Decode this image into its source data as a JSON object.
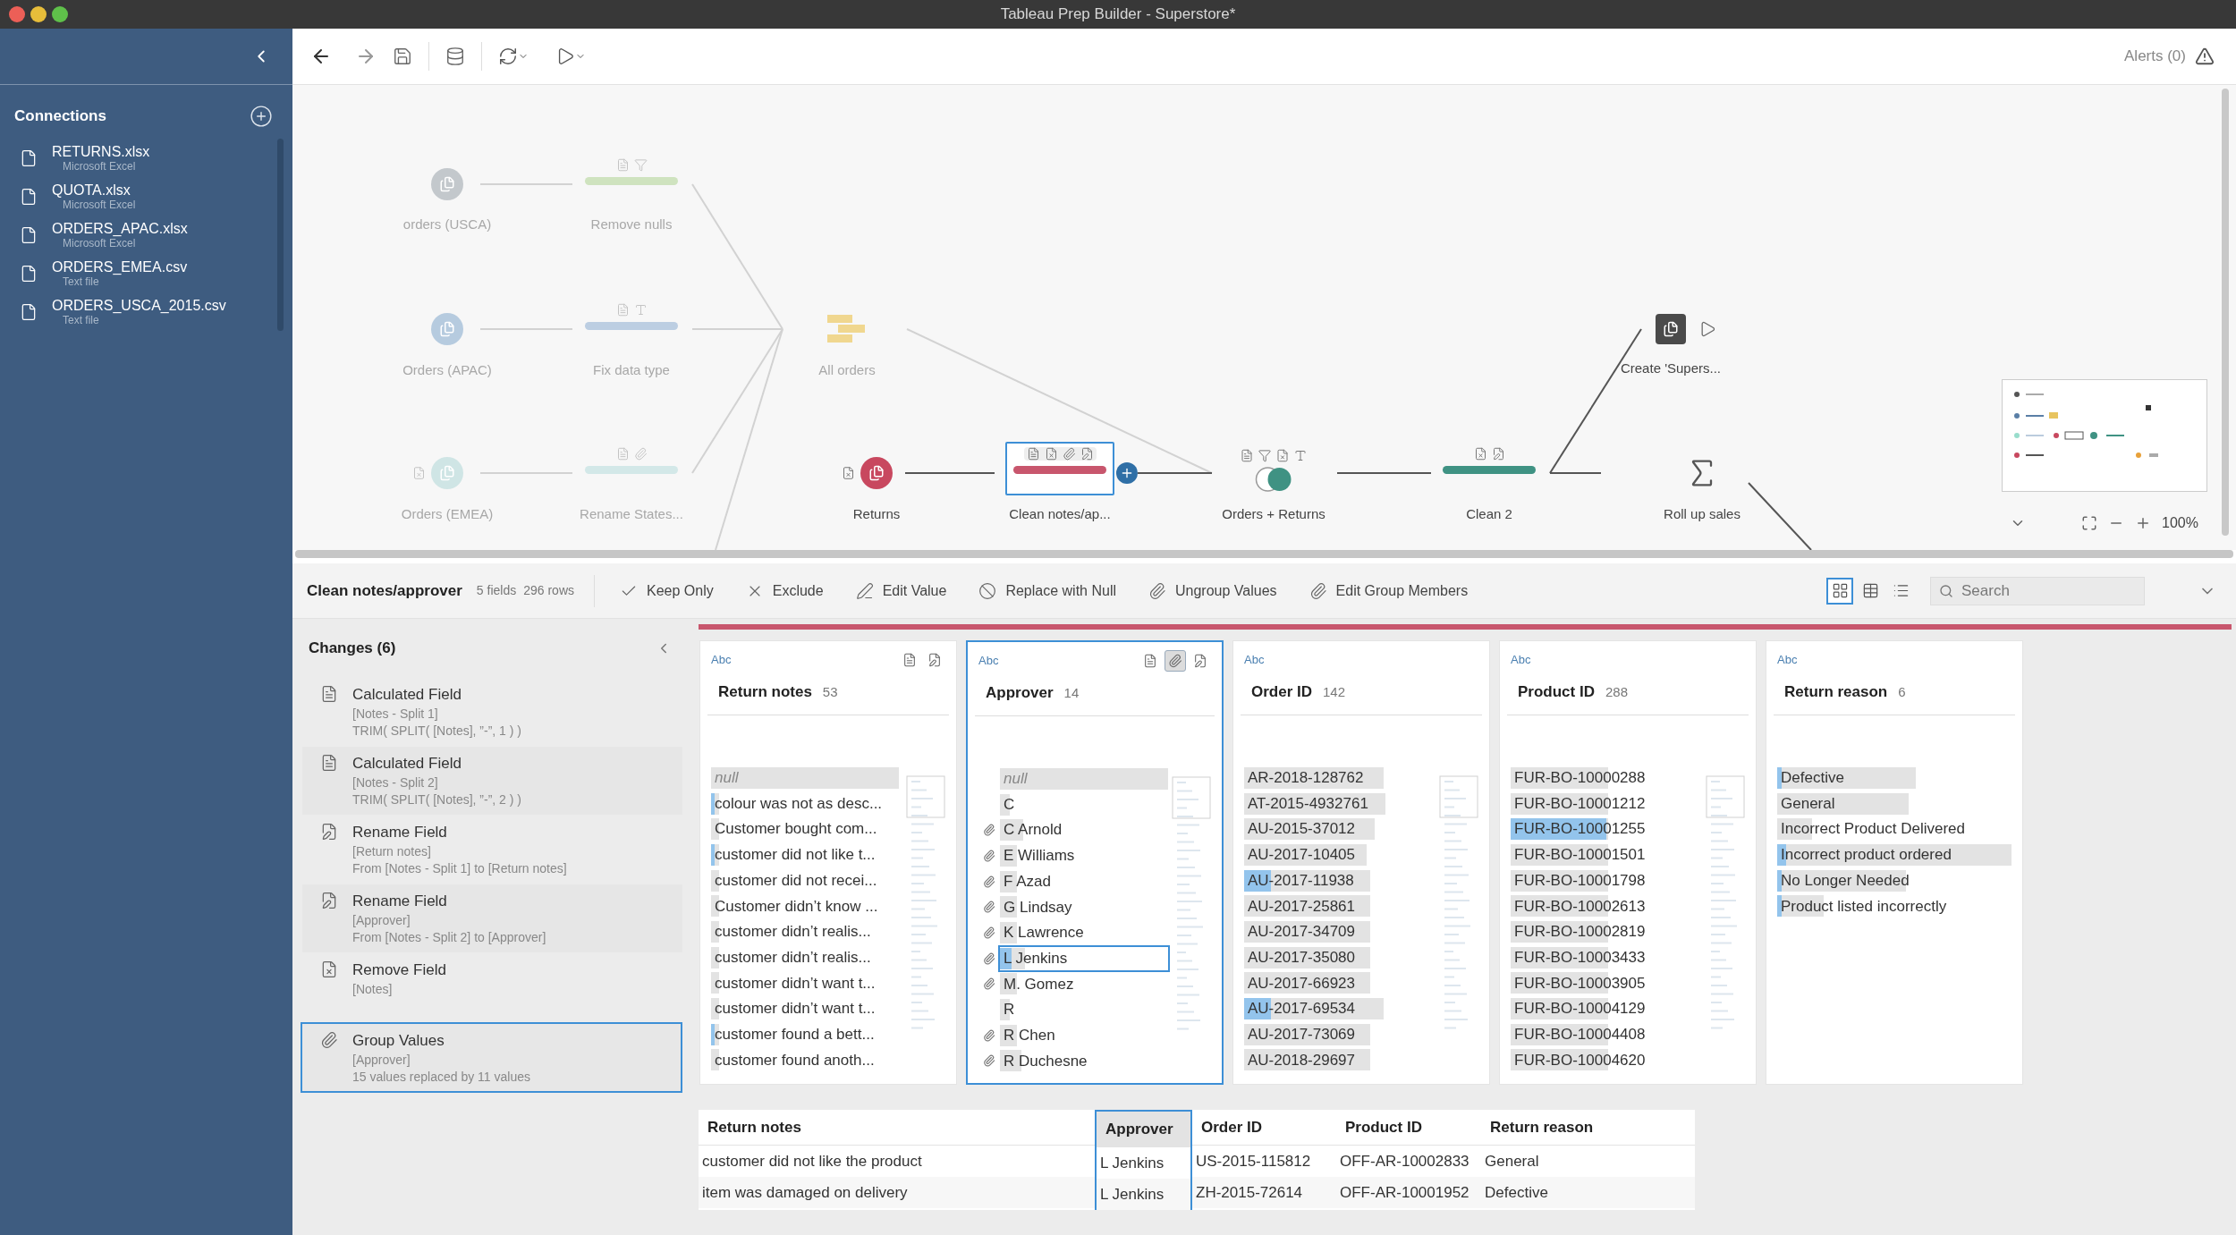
{
  "window": {
    "title": "Tableau Prep Builder - Superstore*"
  },
  "sidebar": {
    "title": "Connections",
    "items": [
      {
        "name": "RETURNS.xlsx",
        "type": "Microsoft Excel"
      },
      {
        "name": "QUOTA.xlsx",
        "type": "Microsoft Excel"
      },
      {
        "name": "ORDERS_APAC.xlsx",
        "type": "Microsoft Excel"
      },
      {
        "name": "ORDERS_EMEA.csv",
        "type": "Text file"
      },
      {
        "name": "ORDERS_USCA_2015.csv",
        "type": "Text file"
      }
    ]
  },
  "toolbar": {
    "alerts": "Alerts (0)"
  },
  "flow": {
    "zoom": "100%",
    "nodes": [
      {
        "kind": "input",
        "label": "orders (USCA)",
        "color": "#c3c8cc",
        "faded": true,
        "selected": false
      },
      {
        "kind": "clean",
        "label": "Remove nulls",
        "color": "#cfe3bf",
        "faded": true,
        "selected": false
      },
      {
        "kind": "input",
        "label": "Orders (APAC)",
        "color": "#b6cbdf",
        "faded": true,
        "selected": false
      },
      {
        "kind": "clean",
        "label": "Fix data type",
        "color": "#bccee2",
        "faded": true,
        "selected": false
      },
      {
        "kind": "input",
        "label": "Orders (EMEA)",
        "color": "#cfe5e5",
        "faded": true,
        "selected": false
      },
      {
        "kind": "clean",
        "label": "Rename States...",
        "color": "#d3e8e8",
        "faded": true,
        "selected": false
      },
      {
        "kind": "union",
        "label": "All orders",
        "color": "#f0d78f",
        "faded": true,
        "selected": false
      },
      {
        "kind": "input",
        "label": "Returns",
        "color": "#c8485f",
        "faded": false,
        "selected": false
      },
      {
        "kind": "clean",
        "label": "Clean notes/ap...",
        "color": "#c8566d",
        "faded": false,
        "selected": true
      },
      {
        "kind": "join",
        "label": "Orders + Returns",
        "color": "#3f9283",
        "faded": false,
        "selected": false
      },
      {
        "kind": "clean",
        "label": "Clean 2",
        "color": "#3f9283",
        "faded": false,
        "selected": false
      },
      {
        "kind": "output",
        "label": "Create 'Supers...",
        "color": "#4a4a4a",
        "faded": false,
        "selected": false
      },
      {
        "kind": "aggregate",
        "label": "Roll up sales",
        "color": "#555555",
        "faded": false,
        "selected": false
      }
    ]
  },
  "step": {
    "title": "Clean notes/approver",
    "fields": "5 fields",
    "rows": "296 rows",
    "color": "#c8566d",
    "search": {
      "placeholder": "Search"
    },
    "actions": [
      {
        "kind": "keep",
        "label": "Keep Only"
      },
      {
        "kind": "exclude",
        "label": "Exclude"
      },
      {
        "kind": "edit",
        "label": "Edit Value"
      },
      {
        "kind": "null",
        "label": "Replace with Null"
      },
      {
        "kind": "ungroup",
        "label": "Ungroup Values"
      },
      {
        "kind": "group",
        "label": "Edit Group Members"
      }
    ],
    "views": [
      {
        "kind": "profile",
        "selected": true
      },
      {
        "kind": "table",
        "selected": false
      },
      {
        "kind": "list",
        "selected": false
      }
    ]
  },
  "changes": {
    "title": "Changes (6)",
    "items": [
      {
        "kind": "calc",
        "title": "Calculated Field",
        "lines": [
          "[Notes - Split 1]",
          "TRIM( SPLIT( [Notes], ”-”, 1 ) )"
        ],
        "selected": false
      },
      {
        "kind": "calc",
        "title": "Calculated Field",
        "lines": [
          "[Notes - Split 2]",
          "TRIM( SPLIT( [Notes], ”-”, 2 ) )"
        ],
        "selected": false
      },
      {
        "kind": "rename",
        "title": "Rename Field",
        "lines": [
          "[Return notes]",
          "From [Notes - Split 1] to [Return notes]"
        ],
        "selected": false
      },
      {
        "kind": "rename",
        "title": "Rename Field",
        "lines": [
          "[Approver]",
          "From [Notes - Split 2] to [Approver]"
        ],
        "selected": false
      },
      {
        "kind": "remove",
        "title": "Remove Field",
        "lines": [
          "[Notes]"
        ],
        "selected": false
      },
      {
        "kind": "group",
        "title": "Group Values",
        "lines": [
          "[Approver]",
          "15 values replaced by 11 values"
        ],
        "selected": true
      }
    ]
  },
  "profile": {
    "cards": [
      {
        "type": "Abc",
        "title": "Return notes",
        "count": "53",
        "selected": false,
        "tools": [
          {
            "kind": "calc",
            "selected": false
          },
          {
            "kind": "rename",
            "selected": false
          }
        ],
        "values": [
          {
            "kind": "null",
            "text": "null",
            "level": 0.98,
            "selected": false
          },
          {
            "kind": "value",
            "text": "colour was not as desc...",
            "level": 0.04,
            "highlight": {
              "level": 0.02
            },
            "selected": false
          },
          {
            "kind": "value",
            "text": "Customer bought com...",
            "level": 0.04,
            "selected": false
          },
          {
            "kind": "value",
            "text": "customer did not like t...",
            "level": 0.04,
            "highlight": {
              "level": 0.02
            },
            "selected": false
          },
          {
            "kind": "value",
            "text": "customer did not recei...",
            "level": 0.04,
            "selected": false
          },
          {
            "kind": "value",
            "text": "Customer didn’t know ...",
            "level": 0.04,
            "selected": false
          },
          {
            "kind": "value",
            "text": "customer didn’t realis...",
            "level": 0.04,
            "selected": false
          },
          {
            "kind": "value",
            "text": "customer didn’t realis...",
            "level": 0.04,
            "selected": false
          },
          {
            "kind": "value",
            "text": "customer didn’t want t...",
            "level": 0.04,
            "selected": false
          },
          {
            "kind": "value",
            "text": "customer didn’t want t...",
            "level": 0.04,
            "selected": false
          },
          {
            "kind": "value",
            "text": "customer found a bett...",
            "level": 0.04,
            "highlight": {
              "level": 0.02
            },
            "selected": false
          },
          {
            "kind": "value",
            "text": "customer found anoth...",
            "level": 0.04,
            "selected": false
          }
        ]
      },
      {
        "type": "Abc",
        "title": "Approver",
        "count": "14",
        "selected": true,
        "tools": [
          {
            "kind": "calc",
            "selected": false
          },
          {
            "kind": "group",
            "selected": true
          },
          {
            "kind": "rename",
            "selected": false
          }
        ],
        "values": [
          {
            "kind": "null",
            "text": "null",
            "level": 1,
            "selected": false,
            "grouped": false
          },
          {
            "kind": "value",
            "text": "C",
            "level": 0.06,
            "selected": false,
            "grouped": false
          },
          {
            "kind": "value",
            "text": "C Arnold",
            "level": 0.14,
            "selected": false,
            "grouped": true
          },
          {
            "kind": "value",
            "text": "E Williams",
            "level": 0.1,
            "selected": false,
            "grouped": true
          },
          {
            "kind": "value",
            "text": "F Azad",
            "level": 0.1,
            "selected": false,
            "grouped": true
          },
          {
            "kind": "value",
            "text": "G Lindsay",
            "level": 0.1,
            "selected": false,
            "grouped": true
          },
          {
            "kind": "value",
            "text": "K Lawrence",
            "level": 0.1,
            "selected": false,
            "grouped": true
          },
          {
            "kind": "value",
            "text": "L Jenkins",
            "level": 0.15,
            "highlight": {
              "level": 0.07
            },
            "selected": true,
            "grouped": true
          },
          {
            "kind": "value",
            "text": "M.  Gomez",
            "level": 0.1,
            "selected": false,
            "grouped": true
          },
          {
            "kind": "value",
            "text": "R",
            "level": 0.06,
            "selected": false,
            "grouped": false
          },
          {
            "kind": "value",
            "text": "R Chen",
            "level": 0.1,
            "selected": false,
            "grouped": true
          },
          {
            "kind": "value",
            "text": "R Duchesne",
            "level": 0.13,
            "selected": false,
            "grouped": true
          }
        ]
      },
      {
        "type": "Abc",
        "title": "Order ID",
        "count": "142",
        "selected": false,
        "values": [
          {
            "kind": "value",
            "text": "AR-2018-128762",
            "level": 0.73,
            "selected": false
          },
          {
            "kind": "value",
            "text": "AT-2015-4932761",
            "level": 0.74,
            "selected": false
          },
          {
            "kind": "value",
            "text": "AU-2015-37012",
            "level": 0.68,
            "selected": false
          },
          {
            "kind": "value",
            "text": "AU-2017-10405",
            "level": 0.64,
            "selected": false
          },
          {
            "kind": "value",
            "text": "AU-2017-11938",
            "level": 0.66,
            "highlight": {
              "level": 0.14
            },
            "selected": false
          },
          {
            "kind": "value",
            "text": "AU-2017-25861",
            "level": 0.66,
            "selected": false
          },
          {
            "kind": "value",
            "text": "AU-2017-34709",
            "level": 0.66,
            "selected": false
          },
          {
            "kind": "value",
            "text": "AU-2017-35080",
            "level": 0.66,
            "selected": false
          },
          {
            "kind": "value",
            "text": "AU-2017-66923",
            "level": 0.66,
            "selected": false
          },
          {
            "kind": "value",
            "text": "AU-2017-69534",
            "level": 0.73,
            "highlight": {
              "level": 0.14
            },
            "selected": false
          },
          {
            "kind": "value",
            "text": "AU-2017-73069",
            "level": 0.66,
            "selected": false
          },
          {
            "kind": "value",
            "text": "AU-2018-29697",
            "level": 0.66,
            "selected": false
          }
        ]
      },
      {
        "type": "Abc",
        "title": "Product ID",
        "count": "288",
        "selected": false,
        "values": [
          {
            "kind": "value",
            "text": "FUR-BO-10000288",
            "level": 0.51,
            "selected": false
          },
          {
            "kind": "value",
            "text": "FUR-BO-10001212",
            "level": 0.51,
            "selected": false
          },
          {
            "kind": "value",
            "text": "FUR-BO-10001255",
            "level": 0.51,
            "highlight": {
              "level": 0.5
            },
            "selected": false
          },
          {
            "kind": "value",
            "text": "FUR-BO-10001501",
            "level": 0.51,
            "selected": false
          },
          {
            "kind": "value",
            "text": "FUR-BO-10001798",
            "level": 0.51,
            "selected": false
          },
          {
            "kind": "value",
            "text": "FUR-BO-10002613",
            "level": 0.51,
            "selected": false
          },
          {
            "kind": "value",
            "text": "FUR-BO-10002819",
            "level": 0.51,
            "selected": false
          },
          {
            "kind": "value",
            "text": "FUR-BO-10003433",
            "level": 0.51,
            "selected": false
          },
          {
            "kind": "value",
            "text": "FUR-BO-10003905",
            "level": 0.51,
            "selected": false
          },
          {
            "kind": "value",
            "text": "FUR-BO-10004129",
            "level": 0.51,
            "selected": false
          },
          {
            "kind": "value",
            "text": "FUR-BO-10004408",
            "level": 0.51,
            "selected": false
          },
          {
            "kind": "value",
            "text": "FUR-BO-10004620",
            "level": 0.51,
            "selected": false
          }
        ]
      },
      {
        "type": "Abc",
        "title": "Return reason",
        "count": "6",
        "selected": false,
        "values": [
          {
            "kind": "value",
            "text": "Defective",
            "level": 0.59,
            "highlight": {
              "level": 0.02
            },
            "selected": false
          },
          {
            "kind": "value",
            "text": "General",
            "level": 0.56,
            "selected": false
          },
          {
            "kind": "value",
            "text": "Incorrect Product Delivered",
            "level": 0.15,
            "selected": false
          },
          {
            "kind": "value",
            "text": "Incorrect product ordered",
            "level": 1,
            "highlight": {
              "level": 0.04
            },
            "selected": false
          },
          {
            "kind": "value",
            "text": "No Longer Needed",
            "level": 0.55,
            "highlight": {
              "level": 0.02
            },
            "selected": false
          },
          {
            "kind": "value",
            "text": "Product listed incorrectly",
            "level": 0.2,
            "highlight": {
              "level": 0.02
            },
            "selected": false
          }
        ]
      }
    ]
  },
  "table": {
    "columns": [
      {
        "label": "Return notes",
        "selected": false
      },
      {
        "label": "Approver",
        "selected": true
      },
      {
        "label": "Order ID",
        "selected": false
      },
      {
        "label": "Product ID",
        "selected": false
      },
      {
        "label": "Return reason",
        "selected": false
      }
    ],
    "rows": [
      [
        "customer did not like the product",
        "L Jenkins",
        "US-2015-115812",
        "OFF-AR-10002833",
        "General"
      ],
      [
        "item was damaged on delivery",
        "L Jenkins",
        "ZH-2015-72614",
        "OFF-AR-10001952",
        "Defective"
      ]
    ]
  }
}
